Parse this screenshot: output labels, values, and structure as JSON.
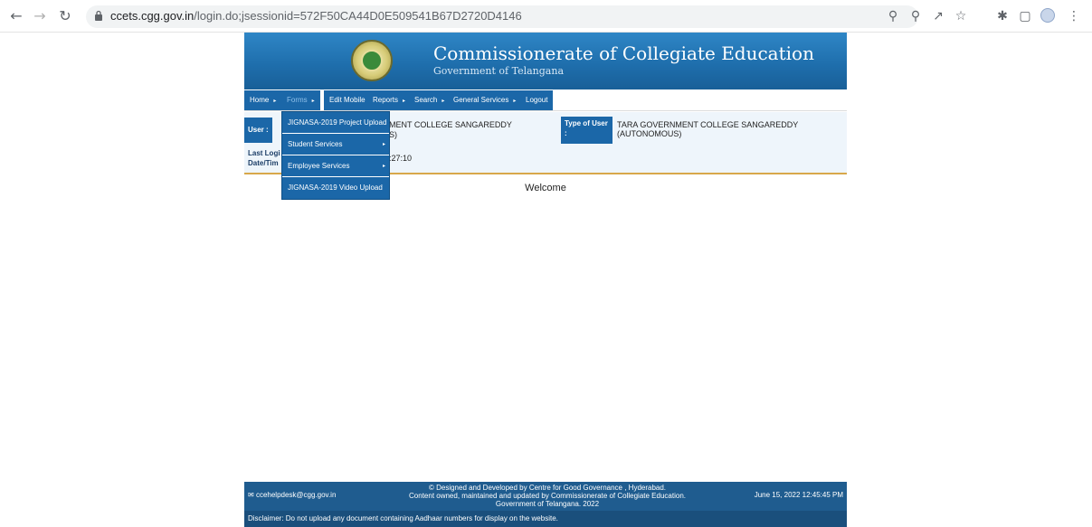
{
  "browser": {
    "url_host": "ccets.cgg.gov.in",
    "url_path": "/login.do;jsessionid=572F50CA44D0E509541B67D2720D4146"
  },
  "header": {
    "title": "Commissionerate of Collegiate Education",
    "subtitle": "Government of Telangana"
  },
  "menu": {
    "items": [
      {
        "label": "Home",
        "arrow": "▸"
      },
      {
        "label": "Forms",
        "arrow": "▸"
      },
      {
        "label": "Edit Mobile",
        "arrow": ""
      },
      {
        "label": "Reports",
        "arrow": "▸"
      },
      {
        "label": "Search",
        "arrow": "▸"
      },
      {
        "label": "General Services",
        "arrow": "▸"
      },
      {
        "label": "Logout",
        "arrow": ""
      }
    ]
  },
  "dropdown": {
    "items": [
      {
        "label": "JIGNASA-2019 Project Upload",
        "arrow": ""
      },
      {
        "label": "Student Services",
        "arrow": "▸"
      },
      {
        "label": "Employee Services",
        "arrow": "▸"
      },
      {
        "label": "JIGNASA-2019 Video Upload",
        "arrow": ""
      }
    ]
  },
  "user_info": {
    "user_label": "User :",
    "user_value_line1": "MENT COLLEGE SANGAREDDY",
    "user_value_line2": "S)",
    "type_label_line1": "Type of User",
    "type_label_line2": ":",
    "type_value_line1": "TARA GOVERNMENT COLLEGE SANGAREDDY",
    "type_value_line2": "(AUTONOMOUS)",
    "last_login_label_line1": "Last Logi",
    "last_login_label_line2": "Date/Tim",
    "last_login_value": ":27:10"
  },
  "welcome": "Welcome",
  "footer": {
    "email": "ccehelpdesk@cgg.gov.in",
    "credit_line1": "© Designed and Developed by Centre for Good Governance , Hyderabad.",
    "credit_line2": "Content owned, maintained and updated by Commissionerate of Collegiate Education.",
    "credit_line3": "Government of Telangana. 2022",
    "datetime": "June 15, 2022 12:45:45 PM",
    "disclaimer": "Disclaimer:  Do not upload any document containing Aadhaar numbers for display on the website."
  },
  "colors": {
    "menu_blue": "#1b67a8",
    "header_blue": "#2f86c6",
    "footer_blue": "#1f5c8f",
    "accent_gold": "#d8a84a"
  }
}
